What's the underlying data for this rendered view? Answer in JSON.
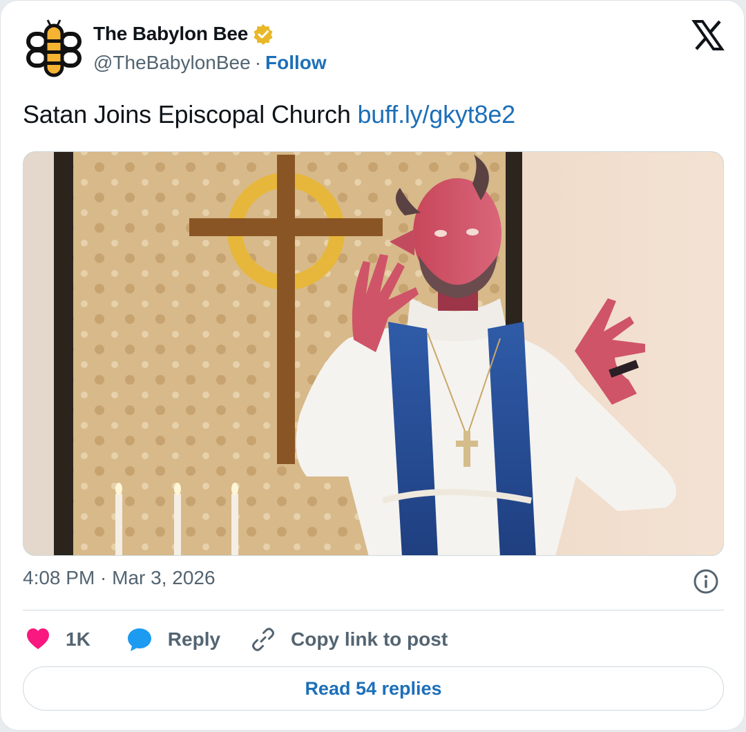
{
  "account": {
    "display_name": "The Babylon Bee",
    "handle": "@TheBabylonBee",
    "separator": "·",
    "follow_label": "Follow",
    "verified_color": "#e8b829"
  },
  "tweet": {
    "text": "Satan Joins Episcopal Church",
    "link": "buff.ly/gkyt8e2",
    "timestamp": "4:08 PM · Mar 3, 2026"
  },
  "actions": {
    "like_count": "1K",
    "reply_label": "Reply",
    "copy_label": "Copy link to post"
  },
  "footer": {
    "read_replies_label": "Read 54 replies"
  },
  "colors": {
    "link": "#1d6fb8",
    "heart": "#f91880",
    "reply_bubble": "#1d9bf0",
    "muted": "#536471"
  },
  "icons": [
    "babylon-bee-logo",
    "verified-badge-icon",
    "x-logo-icon",
    "info-icon",
    "heart-icon",
    "reply-bubble-icon",
    "link-icon"
  ]
}
